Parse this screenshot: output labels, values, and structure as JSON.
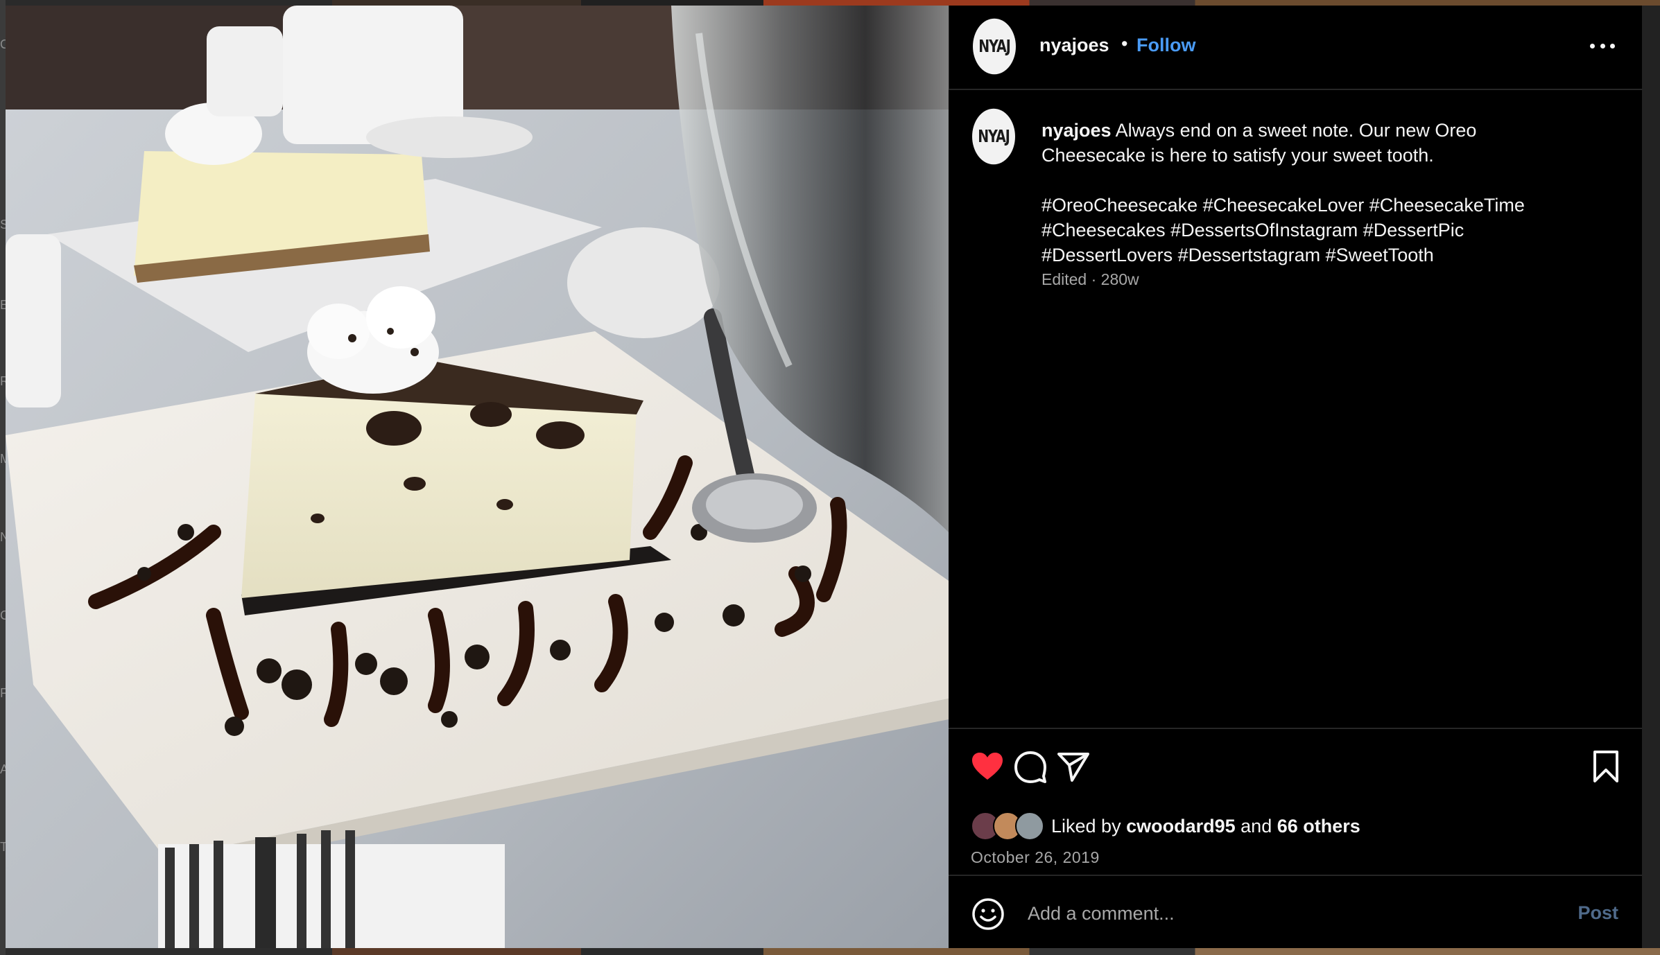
{
  "post": {
    "username": "nyajoes",
    "avatar_text": "NYAJ",
    "separator": "•",
    "follow_label": "Follow",
    "caption_lines": [
      "Always end on a sweet note. Our new Oreo",
      "Cheesecake is here to satisfy your sweet tooth."
    ],
    "hashtag_lines": [
      "#OreoCheesecake #CheesecakeLover #CheesecakeTime",
      "#Cheesecakes #DessertsOfInstagram #DessertPic",
      "#DessertLovers #Dessertstagram #SweetTooth"
    ],
    "edited_label": "Edited",
    "age": "280w",
    "meta_separator": "·",
    "liked_by_prefix": "Liked by",
    "liked_by_user": "cwoodard95",
    "liked_by_and": "and",
    "liked_by_others": "66 others",
    "date": "October 26, 2019",
    "liked": true
  },
  "comment": {
    "placeholder": "Add a comment...",
    "post_label": "Post"
  },
  "icons": {
    "more": "more-horizontal-icon",
    "like": "heart-icon",
    "comment": "comment-bubble-icon",
    "share": "share-paper-plane-icon",
    "save": "bookmark-icon",
    "emoji": "emoji-smiley-icon"
  },
  "colors": {
    "background": "#000000",
    "text": "#f5f5f5",
    "secondary_text": "#a8a8a8",
    "link_blue": "#4a9bf6",
    "like_red": "#ff3040",
    "divider": "#262626",
    "post_disabled": "#4f6a8a"
  },
  "background_letters": [
    "C",
    "S",
    "E",
    "R",
    "M",
    "N",
    "C",
    "F",
    "A",
    "T"
  ]
}
